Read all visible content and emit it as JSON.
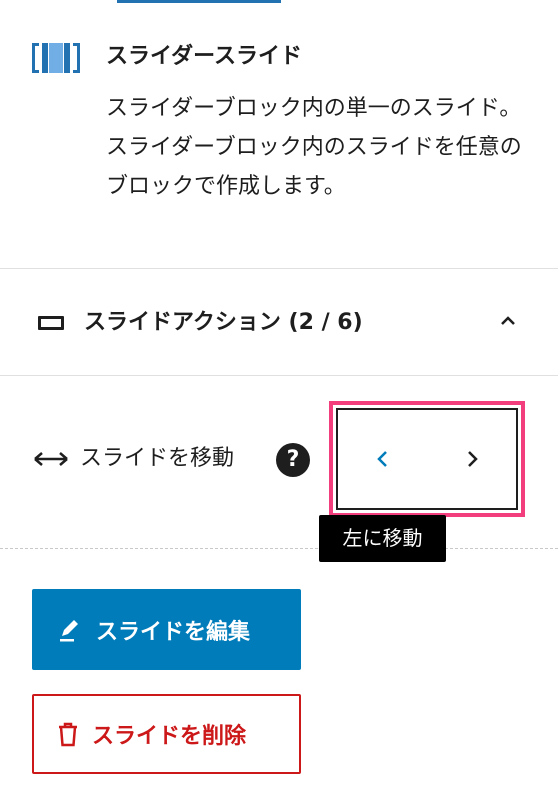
{
  "block": {
    "title": "スライダースライド",
    "description": "スライダーブロック内の単一のスライド。スライダーブロック内のスライドを任意のブロックで作成します。"
  },
  "panel": {
    "title": "スライドアクション (2 / 6)",
    "icon": "slide-rectangle-icon"
  },
  "move": {
    "label": "スライドを移動",
    "help": "?",
    "tooltip": "左に移動"
  },
  "actions": {
    "edit_label": "スライドを編集",
    "delete_label": "スライドを削除"
  },
  "colors": {
    "accent": "#007cba",
    "tab_indicator": "#2271b1",
    "danger": "#cc1818",
    "highlight": "#f33e7e",
    "block_icon_blue": "#2271b1"
  }
}
